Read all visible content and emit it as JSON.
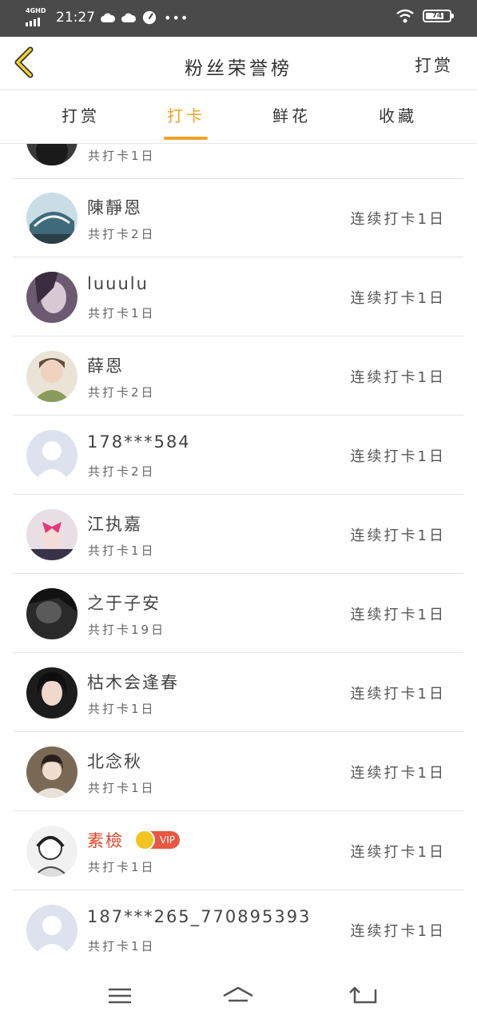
{
  "status_bar": {
    "network": "4GHD",
    "time": "21:27",
    "battery": "74",
    "icons": [
      "network-signal-icon",
      "cloud-icon",
      "cloud-icon",
      "speed-icon",
      "more-dots-icon",
      "wifi-icon",
      "battery-icon"
    ]
  },
  "nav": {
    "title": "粉丝荣誉榜",
    "right_action": "打赏",
    "back_icon": "chevron-left-icon"
  },
  "tabs": [
    {
      "label": "打赏",
      "active": false
    },
    {
      "label": "打卡",
      "active": true
    },
    {
      "label": "鲜花",
      "active": false
    },
    {
      "label": "收藏",
      "active": false
    }
  ],
  "colors": {
    "accent": "#f0a325",
    "vip_name": "#e0452b",
    "vip_badge": "#e85742"
  },
  "list": {
    "partial_top": {
      "total": "共打卡1日"
    },
    "rows": [
      {
        "name": "陳靜恩",
        "total": "共打卡2日",
        "streak": "连续打卡1日"
      },
      {
        "name": "luuulu",
        "total": "共打卡1日",
        "streak": "连续打卡1日"
      },
      {
        "name": "薛恩",
        "total": "共打卡2日",
        "streak": "连续打卡1日"
      },
      {
        "name": "178***584",
        "total": "共打卡2日",
        "streak": "连续打卡1日"
      },
      {
        "name": "江执嘉",
        "total": "共打卡1日",
        "streak": "连续打卡1日"
      },
      {
        "name": "之于子安",
        "total": "共打卡19日",
        "streak": "连续打卡1日"
      },
      {
        "name": "枯木会逢春",
        "total": "共打卡1日",
        "streak": "连续打卡1日"
      },
      {
        "name": "北念秋",
        "total": "共打卡1日",
        "streak": "连续打卡1日"
      },
      {
        "name": "素檢",
        "total": "共打卡1日",
        "streak": "连续打卡1日",
        "vip": "VIP"
      },
      {
        "name": "187***265_770895393",
        "total": "共打卡1日",
        "streak": "连续打卡1日"
      }
    ]
  },
  "bottom_nav": [
    "menu-icon",
    "home-icon",
    "back-icon"
  ]
}
